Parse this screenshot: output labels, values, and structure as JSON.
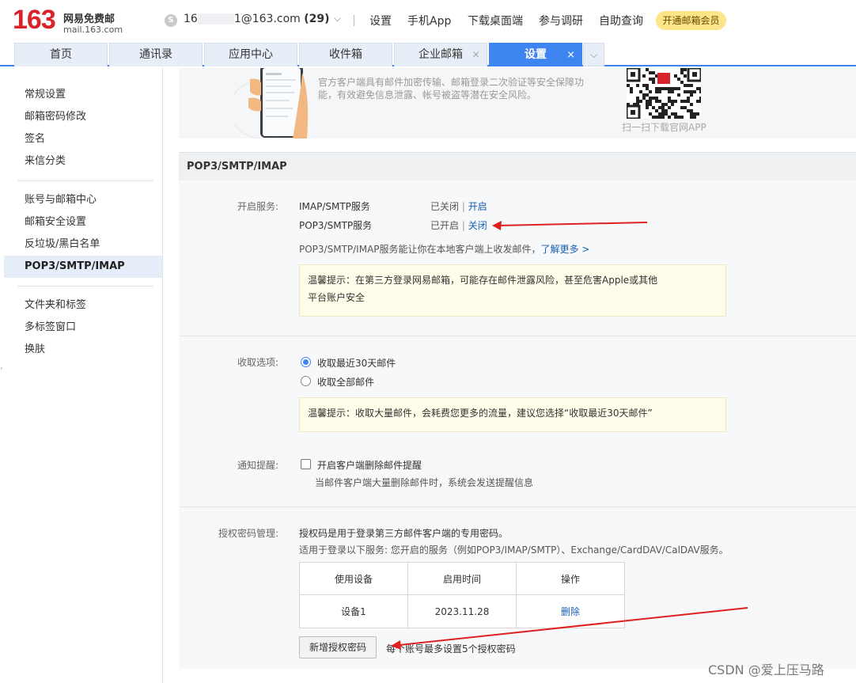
{
  "header": {
    "logo_number": "163",
    "logo_cn": "网易免费邮",
    "logo_url": "mail.163.com",
    "user_prefix": "16",
    "user_suffix": "1@163.com",
    "unread_count": "(29)",
    "links": [
      "设置",
      "手机App",
      "下载桌面端",
      "参与调研",
      "自助查询"
    ],
    "vip_button": "开通邮箱会员"
  },
  "tabs": [
    {
      "label": "首页"
    },
    {
      "label": "通讯录"
    },
    {
      "label": "应用中心"
    },
    {
      "label": "收件箱"
    },
    {
      "label": "企业邮箱",
      "close": "×"
    },
    {
      "label": "设置",
      "close": "×"
    }
  ],
  "sidebar": {
    "items": [
      "常规设置",
      "邮箱密码修改",
      "签名",
      "来信分类",
      "账号与邮箱中心",
      "邮箱安全设置",
      "反垃圾/黑白名单",
      "POP3/SMTP/IMAP",
      "文件夹和标签",
      "多标签窗口",
      "换肤"
    ],
    "active": "POP3/SMTP/IMAP"
  },
  "promo": {
    "text": "官方客户端具有邮件加密传输、邮箱登录二次验证等安全保障功能，有效避免信息泄露、帐号被盗等潜在安全风险。",
    "qr_caption": "扫一扫下载官网APP"
  },
  "section_title": "POP3/SMTP/IMAP",
  "services": {
    "label": "开启服务:",
    "items": [
      {
        "name": "IMAP/SMTP服务",
        "status": "已关闭",
        "action": "开启"
      },
      {
        "name": "POP3/SMTP服务",
        "status": "已开启",
        "action": "关闭"
      }
    ],
    "desc": "POP3/SMTP/IMAP服务能让你在本地客户端上收发邮件，",
    "learn_more": "了解更多 >",
    "tip_line1": "温馨提示：在第三方登录网易邮箱，可能存在邮件泄露风险，甚至危害Apple或其他",
    "tip_line2": "平台账户安全"
  },
  "receive": {
    "label": "收取选项:",
    "options": [
      "收取最近30天邮件",
      "收取全部邮件"
    ],
    "selected": "收取最近30天邮件",
    "tip": "温馨提示：收取大量邮件，会耗费您更多的流量，建议您选择“收取最近30天邮件”"
  },
  "notify": {
    "label": "通知提醒:",
    "checkbox_label": "开启客户端删除邮件提醒",
    "desc": "当邮件客户端大量删除邮件时，系统会发送提醒信息"
  },
  "auth": {
    "label": "授权密码管理:",
    "desc1": "授权码是用于登录第三方邮件客户端的专用密码。",
    "desc2": "适用于登录以下服务: 您开启的服务（例如POP3/IMAP/SMTP）、Exchange/CardDAV/CalDAV服务。",
    "columns": [
      "使用设备",
      "启用时间",
      "操作"
    ],
    "rows": [
      {
        "device": "设备1",
        "time": "2023.11.28",
        "action": "删除"
      }
    ],
    "add_button": "新增授权密码",
    "limit_note": "每个账号最多设置5个授权密码"
  },
  "watermark": "CSDN @爱上压马路",
  "colors": {
    "brand_red": "#d8232a",
    "accent_blue": "#3f85f1",
    "link_blue": "#1a5fb4",
    "annotation_red": "#e02020"
  }
}
